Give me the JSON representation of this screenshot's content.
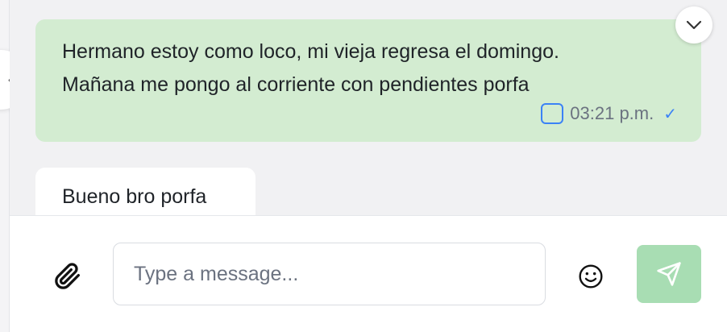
{
  "messages": [
    {
      "direction": "outgoing",
      "lines": [
        "Hermano estoy como loco, mi vieja regresa el domingo.",
        "Mañana me pongo al corriente con pendientes porfa"
      ],
      "time": "03:21 p.m.",
      "status_icon": "✓"
    },
    {
      "direction": "incoming",
      "lines": [
        "Bueno bro porfa"
      ]
    }
  ],
  "composer": {
    "placeholder": "Type a message...",
    "value": ""
  },
  "icons": {
    "collapse": "chevron-left-icon",
    "scroll_down": "chevron-down-icon",
    "attach": "paperclip-icon",
    "emoji": "smiley-icon",
    "send": "send-icon",
    "read_status": "checkmark-icon"
  },
  "colors": {
    "outgoing_bubble": "#d3ecd1",
    "incoming_bubble": "#ffffff",
    "chat_background": "#f1f1f3",
    "send_button": "#a8ddb3",
    "accent_blue": "#3b82f6"
  }
}
